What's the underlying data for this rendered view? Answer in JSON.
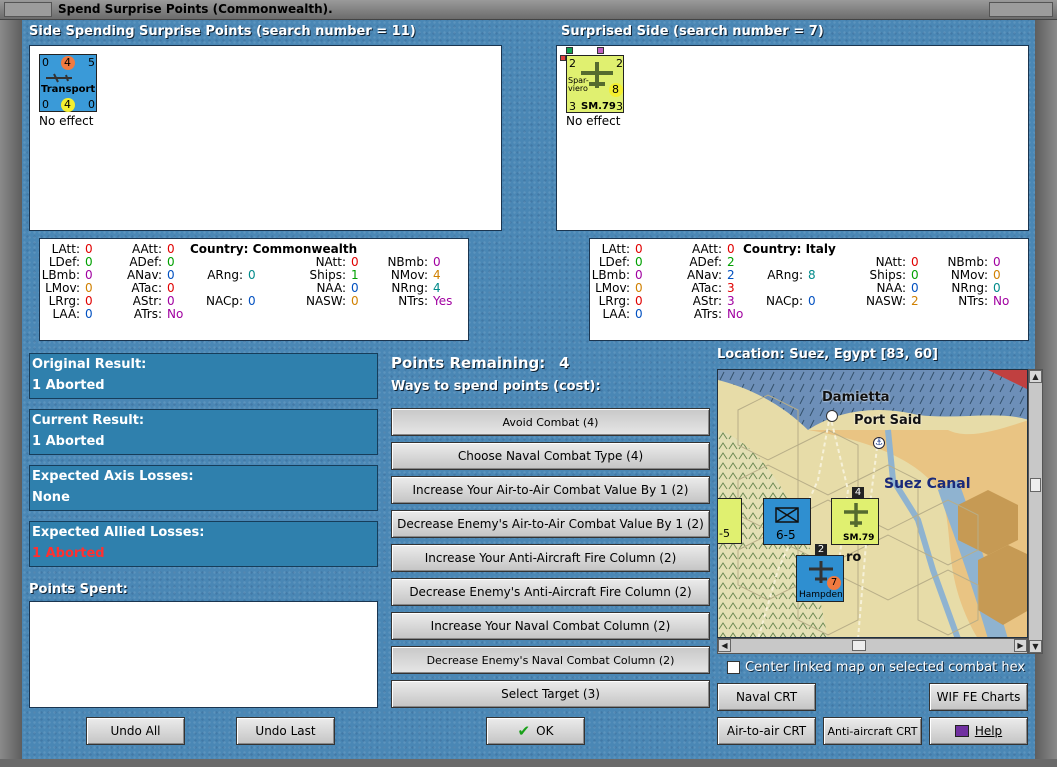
{
  "window": {
    "title": "Spend Surprise Points (Commonwealth)."
  },
  "spending": {
    "header": "Side Spending Surprise Points (search number = 11)",
    "unit": {
      "name": "Transport",
      "tl": "0",
      "tm": "4",
      "tr": "5",
      "bl": "0",
      "bm": "4",
      "br": "0",
      "effect": "No effect"
    },
    "stats": {
      "latt": "0",
      "ldef": "0",
      "lbmb": "0",
      "lmov": "0",
      "lrrg": "0",
      "laa": "0",
      "aatt": "0",
      "adef": "0",
      "anav": "0",
      "atac": "0",
      "astr": "0",
      "atrs": "No",
      "country_label": "Country: Commonwealth",
      "arng": "0",
      "nacp": "0",
      "natt": "0",
      "ships": "1",
      "naa": "0",
      "nasw": "0",
      "nbmb": "0",
      "nmov": "4",
      "nrng": "4",
      "ntrs": "Yes"
    }
  },
  "surprised": {
    "header": "Surprised Side (search number = 7)",
    "unit": {
      "name": "SM.79",
      "sub": "Spar-viero",
      "tl": "2",
      "tr": "2",
      "ml": "1",
      "mr": "8",
      "bl": "3",
      "br": "3",
      "effect": "No effect"
    },
    "stats": {
      "latt": "0",
      "ldef": "0",
      "lbmb": "0",
      "lmov": "0",
      "lrrg": "0",
      "laa": "0",
      "aatt": "0",
      "adef": "2",
      "anav": "2",
      "atac": "3",
      "astr": "3",
      "atrs": "No",
      "country_label": "Country: Italy",
      "arng": "8",
      "nacp": "0",
      "natt": "0",
      "ships": "0",
      "naa": "0",
      "nasw": "2",
      "nbmb": "0",
      "nmov": "0",
      "nrng": "0",
      "ntrs": "No"
    }
  },
  "labels": {
    "latt": "LAtt:",
    "ldef": "LDef:",
    "lbmb": "LBmb:",
    "lmov": "LMov:",
    "lrrg": "LRrg:",
    "laa": "LAA:",
    "aatt": "AAtt:",
    "adef": "ADef:",
    "anav": "ANav:",
    "atac": "ATac:",
    "astr": "AStr:",
    "atrs": "ATrs:",
    "arng": "ARng:",
    "nacp": "NACp:",
    "natt": "NAtt:",
    "ships": "Ships:",
    "naa": "NAA:",
    "nasw": "NASW:",
    "nbmb": "NBmb:",
    "nmov": "NMov:",
    "nrng": "NRng:",
    "ntrs": "NTrs:"
  },
  "results": {
    "original": {
      "label": "Original Result:",
      "value": "1 Aborted"
    },
    "current": {
      "label": "Current Result:",
      "value": "1 Aborted"
    },
    "axis": {
      "label": "Expected Axis Losses:",
      "value": "None"
    },
    "allied": {
      "label": "Expected Allied Losses:",
      "value": "1 Aborted"
    }
  },
  "points_spent": {
    "label": "Points Spent:"
  },
  "points": {
    "remaining_label": "Points Remaining:",
    "remaining": "4",
    "ways_label": "Ways to spend points (cost):"
  },
  "options": [
    "Avoid Combat (4)",
    "Choose Naval Combat Type (4)",
    "Increase Your Air-to-Air Combat Value By 1 (2)",
    "Decrease Enemy's Air-to-Air Combat Value By 1 (2)",
    "Increase Your Anti-Aircraft Fire Column (2)",
    "Decrease Enemy's Anti-Aircraft Fire Column (2)",
    "Increase Your Naval Combat Column (2)",
    "Decrease Enemy's Naval Combat Column (2)",
    "Select Target (3)"
  ],
  "buttons": {
    "undo_all": "Undo All",
    "undo_last": "Undo Last",
    "ok": "OK",
    "naval_crt": "Naval CRT",
    "wif_fe": "WIF FE Charts",
    "air_crt": "Air-to-air CRT",
    "aa_crt": "Anti-aircraft CRT",
    "help": "Help"
  },
  "map": {
    "location": "Location: Suez, Egypt [83, 60]",
    "damietta": "Damietta",
    "port_said": "Port Said",
    "suez_canal": "Suez Canal",
    "cairo_part": "ro",
    "inf_val": "6-5",
    "inf_side": "-5",
    "hampden": "Hampden",
    "hamp_val": "7",
    "stack_top": "2",
    "stack_top2": "4"
  },
  "center_map": {
    "label": "Center linked map on selected combat hex"
  }
}
